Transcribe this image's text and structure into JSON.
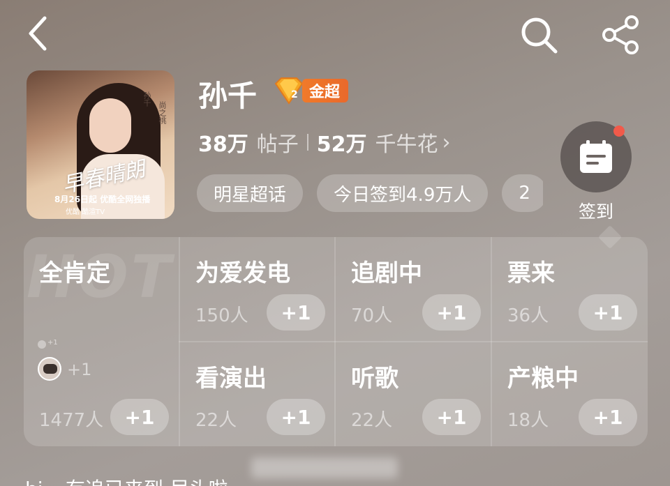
{
  "header": {
    "back_icon": "chevron-left-icon",
    "search_icon": "search-icon",
    "share_icon": "share-icon"
  },
  "profile": {
    "name": "孙千",
    "level_badge": "金超",
    "level_number": "2",
    "stats": {
      "posts_count": "38万",
      "posts_label": "帖子",
      "flowers_count": "52万",
      "flowers_label": "千牛花",
      "chevron": "›"
    },
    "cover_text": {
      "vertical_name": "孙千",
      "vertical_sub": "尚之桃",
      "big_title": "早春晴朗",
      "date": "8月26日起 优酷全网独播",
      "brand": "优酷  酷渲TV"
    }
  },
  "chips": [
    "明星超话",
    "今日签到4.9万人",
    "2"
  ],
  "checkin": {
    "label": "签到",
    "icon": "calendar-note-icon",
    "has_notification": true
  },
  "actions": {
    "big": {
      "title": "全肯定",
      "watermark": "HOT",
      "avatar_plus": "+1",
      "small_plus": "+1",
      "count": "1477人",
      "button": "+1"
    },
    "items": [
      {
        "title": "为爱发电",
        "count": "150人",
        "button": "+1"
      },
      {
        "title": "追剧中",
        "count": "70人",
        "button": "+1"
      },
      {
        "title": "票来",
        "count": "36人",
        "button": "+1"
      },
      {
        "title": "看演出",
        "count": "22人",
        "button": "+1"
      },
      {
        "title": "听歌",
        "count": "22人",
        "button": "+1"
      },
      {
        "title": "产粮中",
        "count": "18人",
        "button": "+1"
      }
    ]
  },
  "teaser": "hi~ 有追已来到 尽头啦"
}
